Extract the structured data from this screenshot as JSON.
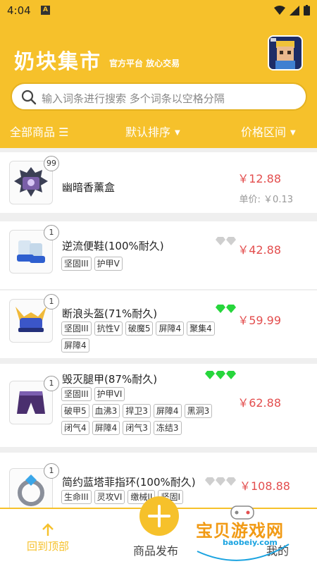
{
  "status": {
    "time": "4:04",
    "indicator": "A"
  },
  "header": {
    "title": "奶块集市",
    "subtitle": "官方平台 放心交易",
    "search_placeholder": "输入词条进行搜索 多个词条以空格分隔"
  },
  "filters": {
    "all": "全部商品 ☰",
    "sort": "默认排序",
    "price": "价格区间"
  },
  "items": [
    {
      "name": "幽暗香薰盒",
      "count": "99",
      "price": "￥12.88",
      "unit": "单价: ￥0.13",
      "tags": [],
      "gems": {
        "color": "none",
        "count": 0
      }
    },
    {
      "name": "逆流便鞋(100%耐久)",
      "count": "1",
      "price": "￥42.88",
      "tags": [
        "坚固III",
        "护甲V"
      ],
      "gems": {
        "color": "#cfcfcf",
        "count": 2
      }
    },
    {
      "name": "断浪头盔(71%耐久)",
      "count": "1",
      "price": "￥59.99",
      "tags": [
        "坚固III",
        "抗性V",
        "破魔5",
        "屏障4",
        "聚集4",
        "屏障4"
      ],
      "gems": {
        "color": "#27d63c",
        "count": 2
      }
    },
    {
      "name": "毁灭腿甲(87%耐久)",
      "count": "1",
      "price": "￥62.88",
      "tags": [
        "坚固III",
        "护甲VI",
        "破甲5",
        "血沸3",
        "捍卫3",
        "屏障4",
        "黑洞3",
        "闭气4",
        "屏障4",
        "闭气3",
        "冻结3"
      ],
      "gems": {
        "color": "#27d63c",
        "count": 3
      }
    },
    {
      "name": "简约蓝塔菲指环(100%耐久)",
      "count": "1",
      "price": "￥108.88",
      "tags": [
        "生命III",
        "灵攻VI",
        "缴械II",
        "坚固I"
      ],
      "gems": {
        "color": "#cfcfcf",
        "count": 3
      }
    }
  ],
  "bottom": {
    "back_to_top": "回到顶部",
    "publish": "商品发布",
    "mine": "我的"
  },
  "watermark": {
    "text": "宝贝游戏网",
    "url": "baobeiy.com"
  },
  "colors": {
    "brand": "#f6c12b",
    "price": "#e34e4e"
  }
}
